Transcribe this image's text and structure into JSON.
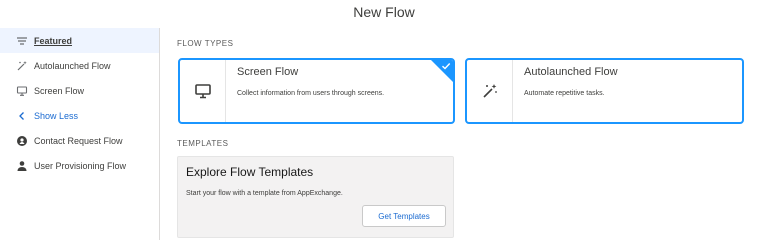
{
  "modal": {
    "title": "New Flow"
  },
  "sidebar": {
    "items": [
      {
        "label": "Featured",
        "icon": "featured-icon"
      },
      {
        "label": "Autolaunched Flow",
        "icon": "magic-wand-icon"
      },
      {
        "label": "Screen Flow",
        "icon": "monitor-icon"
      },
      {
        "label": "Show Less",
        "icon": "chevron-left-icon"
      },
      {
        "label": "Contact Request Flow",
        "icon": "contact-request-icon"
      },
      {
        "label": "User Provisioning Flow",
        "icon": "user-icon"
      }
    ]
  },
  "main": {
    "flow_types_heading": "FLOW TYPES",
    "cards": [
      {
        "title": "Screen Flow",
        "description": "Collect information from users through screens.",
        "icon": "monitor-icon",
        "selected": true
      },
      {
        "title": "Autolaunched Flow",
        "description": "Automate repetitive tasks.",
        "icon": "magic-wand-icon",
        "selected": false
      }
    ],
    "templates_heading": "TEMPLATES",
    "template_card": {
      "title": "Explore Flow Templates",
      "description": "Start your flow with a template from AppExchange.",
      "button_label": "Get Templates"
    }
  },
  "colors": {
    "accent": "#1b96ff",
    "link": "#1b6bd1",
    "active_bg": "#eef4ff",
    "panel_bg": "#f3f2f2"
  }
}
